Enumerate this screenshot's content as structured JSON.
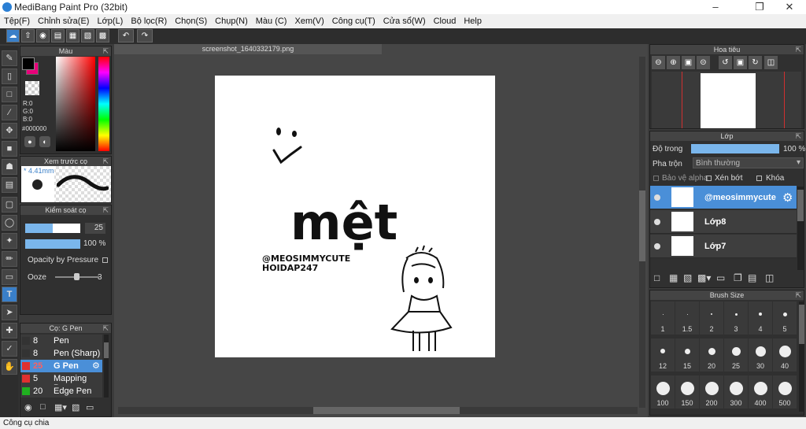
{
  "window": {
    "title": "MediBang Paint Pro (32bit)"
  },
  "menu": [
    "Tệp(F)",
    "Chỉnh sửa(E)",
    "Lớp(L)",
    "Bộ lọc(R)",
    "Chọn(S)",
    "Chụp(N)",
    "Màu (C)",
    "Xem(V)",
    "Công cụ(T)",
    "Cửa sổ(W)",
    "Cloud",
    "Help"
  ],
  "color_panel": {
    "title": "Màu",
    "r": "R:0",
    "g": "G:0",
    "b": "B:0",
    "hex": "#000000",
    "primary": "#000000",
    "secondary": "#e8007a"
  },
  "brush_preview": {
    "title": "Xem trước cọ",
    "size": "* 4.41mm"
  },
  "brush_control": {
    "title": "Kiểm soát cọ",
    "size_value": "25",
    "opacity_value": "100 %",
    "opacity_pressure": "Opacity by Pressure",
    "ooze_label": "Ooze",
    "ooze_value": "3"
  },
  "brush_list": {
    "title": "Cọ: G Pen",
    "items": [
      {
        "size": "8",
        "name": "Pen",
        "color": "#333333"
      },
      {
        "size": "8",
        "name": "Pen (Sharp)",
        "color": "#333333"
      },
      {
        "size": "25",
        "name": "G Pen",
        "color": "#e03030"
      },
      {
        "size": "5",
        "name": "Mapping Pen",
        "color": "#e03030"
      },
      {
        "size": "20",
        "name": "Edge Pen",
        "color": "#20b020"
      }
    ]
  },
  "document": {
    "tab": "screenshot_1640332179.png",
    "artwork_text": {
      "big": "mệt",
      "handle": "@MEOSIMMYCUTE",
      "site": "HOIDAP247"
    }
  },
  "navigator": {
    "title": "Hoa tiêu"
  },
  "layers": {
    "title": "Lớp",
    "opacity_label": "Độ trong",
    "opacity_value": "100 %",
    "blend_label": "Pha trộn",
    "blend_value": "Bình thường",
    "protect_alpha": "Bảo vệ alpha",
    "clipping": "Xén bớt",
    "lock": "Khóa",
    "items": [
      "@meosimmycute",
      "Lớp8",
      "Lớp7"
    ]
  },
  "brush_size": {
    "title": "Brush Size",
    "values": [
      "1",
      "1.5",
      "2",
      "3",
      "4",
      "5",
      "12",
      "15",
      "20",
      "25",
      "30",
      "40",
      "100",
      "150",
      "200",
      "300",
      "400",
      "500"
    ]
  },
  "status": {
    "text": "Công cụ chia"
  }
}
